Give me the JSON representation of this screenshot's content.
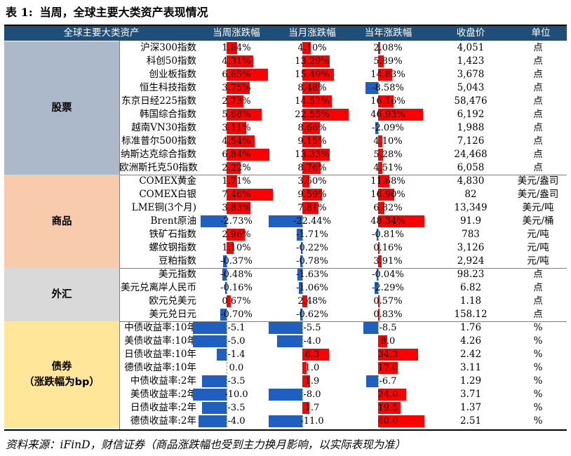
{
  "title": {
    "label": "表 1:",
    "text": "当周，全球主要大类资产表现情况"
  },
  "header": [
    "全球主要大类资产",
    "当周涨跌幅",
    "当月涨跌幅",
    "当年涨跌幅",
    "收盘价",
    "单位"
  ],
  "colors": {
    "header_bg": "#1f4e79",
    "positive_bar": "#ff0000",
    "negative_bar": "#1f5fbf",
    "stocks_bg": "#acb9ca",
    "commodities_bg": "#f8cbad",
    "fx_bg": "#d9d9d9",
    "bonds_bg": "#ffe699"
  },
  "groups": [
    {
      "name": "股票",
      "name2": "",
      "bg": "#acb9ca",
      "rows": [
        {
          "name": "沪深300指数",
          "w": "1.64%",
          "m": "4.10%",
          "y": "2.08%",
          "close": "4,051",
          "unit": "点",
          "wv": 1.64,
          "mv": 4.1,
          "yv": 2.08
        },
        {
          "name": "科创50指数",
          "w": "4.31%",
          "m": "13.29%",
          "y": "5.89%",
          "close": "1,423",
          "unit": "点",
          "wv": 4.31,
          "mv": 13.29,
          "yv": 5.89
        },
        {
          "name": "创业板指数",
          "w": "6.65%",
          "m": "15.49%",
          "y": "14.83%",
          "close": "3,678",
          "unit": "点",
          "wv": 6.65,
          "mv": 15.49,
          "yv": 14.83
        },
        {
          "name": "恒生科技指数",
          "w": "3.75%",
          "m": "8.48%",
          "y": "-8.58%",
          "close": "5,043",
          "unit": "点",
          "wv": 3.75,
          "mv": 8.48,
          "yv": -8.58
        },
        {
          "name": "东京日经225指数",
          "w": "2.73%",
          "m": "14.52%",
          "y": "16.16%",
          "close": "58,476",
          "unit": "点",
          "wv": 2.73,
          "mv": 14.52,
          "yv": 16.16
        },
        {
          "name": "韩国综合指数",
          "w": "5.68%",
          "m": "22.55%",
          "y": "46.93%",
          "close": "6,192",
          "unit": "点",
          "wv": 5.68,
          "mv": 22.55,
          "yv": 46.93
        },
        {
          "name": "越南VN30指数",
          "w": "3.11%",
          "m": "8.66%",
          "y": "-2.09%",
          "close": "1,988",
          "unit": "点",
          "wv": 3.11,
          "mv": 8.66,
          "yv": -2.09
        },
        {
          "name": "标准普尔500指数",
          "w": "4.54%",
          "m": "9.15%",
          "y": "4.10%",
          "close": "7,126",
          "unit": "点",
          "wv": 4.54,
          "mv": 9.15,
          "yv": 4.1
        },
        {
          "name": "纳斯达克综合指数",
          "w": "6.84%",
          "m": "13.33%",
          "y": "5.28%",
          "close": "24,468",
          "unit": "点",
          "wv": 6.84,
          "mv": 13.33,
          "yv": 5.28
        },
        {
          "name": "欧洲斯托克50指数",
          "w": "2.22%",
          "m": "8.76%",
          "y": "4.51%",
          "close": "6,058",
          "unit": "点",
          "wv": 2.22,
          "mv": 8.76,
          "yv": 4.51
        }
      ]
    },
    {
      "name": "商品",
      "name2": "",
      "bg": "#f8cbad",
      "rows": [
        {
          "name": "COMEX黄金",
          "w": "1.71%",
          "m": "3.50%",
          "y": "11.68%",
          "close": "4,830",
          "unit": "美元/盎司",
          "wv": 1.71,
          "mv": 3.5,
          "yv": 11.68
        },
        {
          "name": "COMEX白银",
          "w": "7.46%",
          "m": "9.59%",
          "y": "16.90%",
          "close": "82",
          "unit": "美元/盎司",
          "wv": 7.46,
          "mv": 9.59,
          "yv": 16.9
        },
        {
          "name": "LME铜(3个月)",
          "w": "3.83%",
          "m": "7.81%",
          "y": "6.82%",
          "close": "13,349",
          "unit": "美元/吨",
          "wv": 3.83,
          "mv": 7.81,
          "yv": 6.82
        },
        {
          "name": "Brent原油",
          "w": "-2.73%",
          "m": "-22.44%",
          "y": "48.34%",
          "close": "91.9",
          "unit": "美元/桶",
          "wv": -2.73,
          "mv": -22.44,
          "yv": 48.34
        },
        {
          "name": "铁矿石指数",
          "w": "2.96%",
          "m": "-1.71%",
          "y": "-0.81%",
          "close": "783",
          "unit": "元/吨",
          "wv": 2.96,
          "mv": -1.71,
          "yv": -0.81
        },
        {
          "name": "螺纹钢指数",
          "w": "1.10%",
          "m": "-0.22%",
          "y": "0.16%",
          "close": "3,126",
          "unit": "元/吨",
          "wv": 1.1,
          "mv": -0.22,
          "yv": 0.16
        },
        {
          "name": "豆粕指数",
          "w": "-0.37%",
          "m": "-0.78%",
          "y": "3.91%",
          "close": "2,924",
          "unit": "元/吨",
          "wv": -0.37,
          "mv": -0.78,
          "yv": 3.91
        }
      ]
    },
    {
      "name": "外汇",
      "name2": "",
      "bg": "#d9d9d9",
      "rows": [
        {
          "name": "美元指数",
          "w": "-0.48%",
          "m": "-1.63%",
          "y": "-0.04%",
          "close": "98.23",
          "unit": "点",
          "wv": -0.48,
          "mv": -1.63,
          "yv": -0.04
        },
        {
          "name": "美元兑离岸人民币",
          "w": "-0.16%",
          "m": "-1.06%",
          "y": "-2.29%",
          "close": "6.82",
          "unit": "点",
          "wv": -0.16,
          "mv": -1.06,
          "yv": -2.29
        },
        {
          "name": "欧元兑美元",
          "w": "0.67%",
          "m": "2.48%",
          "y": "0.57%",
          "close": "1.18",
          "unit": "点",
          "wv": 0.67,
          "mv": 2.48,
          "yv": 0.57
        },
        {
          "name": "美元兑日元",
          "w": "-0.70%",
          "m": "-0.62%",
          "y": "0.83%",
          "close": "158.12",
          "unit": "点",
          "wv": -0.7,
          "mv": -0.62,
          "yv": 0.83
        }
      ]
    },
    {
      "name": "债券",
      "name2": "（涨跌幅为bp）",
      "bg": "#ffe699",
      "rows": [
        {
          "name": "中债收益率:10年",
          "w": "-5.1",
          "m": "-5.5",
          "y": "-8.5",
          "close": "1.76",
          "unit": "%",
          "wv": -5.1,
          "mv": -5.5,
          "yv": -8.5
        },
        {
          "name": "美债收益率:10年",
          "w": "-5.0",
          "m": "-4.0",
          "y": "8.0",
          "close": "4.26",
          "unit": "%",
          "wv": -5.0,
          "mv": -4.0,
          "yv": 8.0
        },
        {
          "name": "日债收益率:10年",
          "w": "-1.4",
          "m": "6.3",
          "y": "34.3",
          "close": "2.42",
          "unit": "%",
          "wv": -1.4,
          "mv": 6.3,
          "yv": 34.3
        },
        {
          "name": "德债收益率:10年",
          "w": "0.0",
          "m": "1.0",
          "y": "17.0",
          "close": "3.11",
          "unit": "%",
          "wv": 0.0,
          "mv": 1.0,
          "yv": 17.0
        },
        {
          "name": "中债收益率:2年",
          "w": "-3.5",
          "m": "1.9",
          "y": "-6.7",
          "close": "1.29",
          "unit": "%",
          "wv": -3.5,
          "mv": 1.9,
          "yv": -6.7
        },
        {
          "name": "美债收益率:2年",
          "w": "-10.0",
          "m": "-8.0",
          "y": "24.0",
          "close": "3.71",
          "unit": "%",
          "wv": -10.0,
          "mv": -8.0,
          "yv": 24.0
        },
        {
          "name": "日债收益率:2年",
          "w": "-3.5",
          "m": "1.7",
          "y": "19.5",
          "close": "1.37",
          "unit": "%",
          "wv": -3.5,
          "mv": 1.7,
          "yv": 19.5
        },
        {
          "name": "德债收益率:2年",
          "w": "-4.0",
          "m": "-11.0",
          "y": "40.0",
          "close": "2.51",
          "unit": "%",
          "wv": -4.0,
          "mv": -11.0,
          "yv": 40.0
        }
      ]
    }
  ],
  "footer": "资料来源：iFinD，财信证券（商品涨跌幅也受到主力换月影响，以实际表现为准）"
}
